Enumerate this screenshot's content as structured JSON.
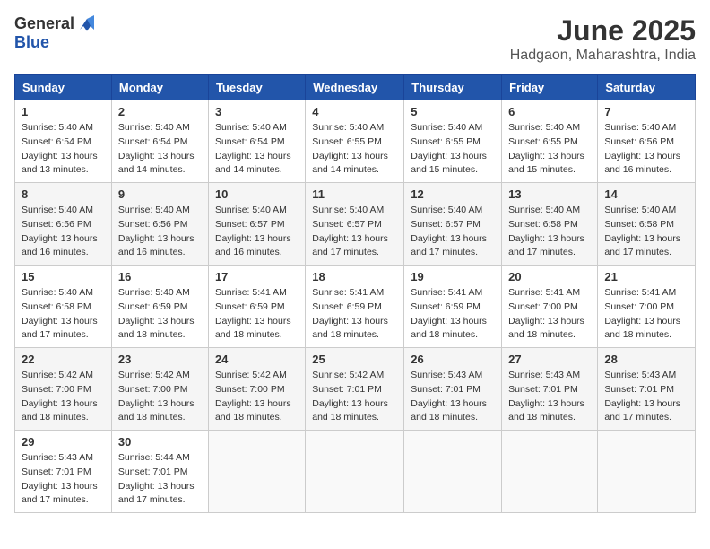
{
  "header": {
    "logo_general": "General",
    "logo_blue": "Blue",
    "month_year": "June 2025",
    "location": "Hadgaon, Maharashtra, India"
  },
  "weekdays": [
    "Sunday",
    "Monday",
    "Tuesday",
    "Wednesday",
    "Thursday",
    "Friday",
    "Saturday"
  ],
  "weeks": [
    [
      {
        "day": "1",
        "sunrise": "Sunrise: 5:40 AM",
        "sunset": "Sunset: 6:54 PM",
        "daylight": "Daylight: 13 hours and 13 minutes."
      },
      {
        "day": "2",
        "sunrise": "Sunrise: 5:40 AM",
        "sunset": "Sunset: 6:54 PM",
        "daylight": "Daylight: 13 hours and 14 minutes."
      },
      {
        "day": "3",
        "sunrise": "Sunrise: 5:40 AM",
        "sunset": "Sunset: 6:54 PM",
        "daylight": "Daylight: 13 hours and 14 minutes."
      },
      {
        "day": "4",
        "sunrise": "Sunrise: 5:40 AM",
        "sunset": "Sunset: 6:55 PM",
        "daylight": "Daylight: 13 hours and 14 minutes."
      },
      {
        "day": "5",
        "sunrise": "Sunrise: 5:40 AM",
        "sunset": "Sunset: 6:55 PM",
        "daylight": "Daylight: 13 hours and 15 minutes."
      },
      {
        "day": "6",
        "sunrise": "Sunrise: 5:40 AM",
        "sunset": "Sunset: 6:55 PM",
        "daylight": "Daylight: 13 hours and 15 minutes."
      },
      {
        "day": "7",
        "sunrise": "Sunrise: 5:40 AM",
        "sunset": "Sunset: 6:56 PM",
        "daylight": "Daylight: 13 hours and 16 minutes."
      }
    ],
    [
      {
        "day": "8",
        "sunrise": "Sunrise: 5:40 AM",
        "sunset": "Sunset: 6:56 PM",
        "daylight": "Daylight: 13 hours and 16 minutes."
      },
      {
        "day": "9",
        "sunrise": "Sunrise: 5:40 AM",
        "sunset": "Sunset: 6:56 PM",
        "daylight": "Daylight: 13 hours and 16 minutes."
      },
      {
        "day": "10",
        "sunrise": "Sunrise: 5:40 AM",
        "sunset": "Sunset: 6:57 PM",
        "daylight": "Daylight: 13 hours and 16 minutes."
      },
      {
        "day": "11",
        "sunrise": "Sunrise: 5:40 AM",
        "sunset": "Sunset: 6:57 PM",
        "daylight": "Daylight: 13 hours and 17 minutes."
      },
      {
        "day": "12",
        "sunrise": "Sunrise: 5:40 AM",
        "sunset": "Sunset: 6:57 PM",
        "daylight": "Daylight: 13 hours and 17 minutes."
      },
      {
        "day": "13",
        "sunrise": "Sunrise: 5:40 AM",
        "sunset": "Sunset: 6:58 PM",
        "daylight": "Daylight: 13 hours and 17 minutes."
      },
      {
        "day": "14",
        "sunrise": "Sunrise: 5:40 AM",
        "sunset": "Sunset: 6:58 PM",
        "daylight": "Daylight: 13 hours and 17 minutes."
      }
    ],
    [
      {
        "day": "15",
        "sunrise": "Sunrise: 5:40 AM",
        "sunset": "Sunset: 6:58 PM",
        "daylight": "Daylight: 13 hours and 17 minutes."
      },
      {
        "day": "16",
        "sunrise": "Sunrise: 5:40 AM",
        "sunset": "Sunset: 6:59 PM",
        "daylight": "Daylight: 13 hours and 18 minutes."
      },
      {
        "day": "17",
        "sunrise": "Sunrise: 5:41 AM",
        "sunset": "Sunset: 6:59 PM",
        "daylight": "Daylight: 13 hours and 18 minutes."
      },
      {
        "day": "18",
        "sunrise": "Sunrise: 5:41 AM",
        "sunset": "Sunset: 6:59 PM",
        "daylight": "Daylight: 13 hours and 18 minutes."
      },
      {
        "day": "19",
        "sunrise": "Sunrise: 5:41 AM",
        "sunset": "Sunset: 6:59 PM",
        "daylight": "Daylight: 13 hours and 18 minutes."
      },
      {
        "day": "20",
        "sunrise": "Sunrise: 5:41 AM",
        "sunset": "Sunset: 7:00 PM",
        "daylight": "Daylight: 13 hours and 18 minutes."
      },
      {
        "day": "21",
        "sunrise": "Sunrise: 5:41 AM",
        "sunset": "Sunset: 7:00 PM",
        "daylight": "Daylight: 13 hours and 18 minutes."
      }
    ],
    [
      {
        "day": "22",
        "sunrise": "Sunrise: 5:42 AM",
        "sunset": "Sunset: 7:00 PM",
        "daylight": "Daylight: 13 hours and 18 minutes."
      },
      {
        "day": "23",
        "sunrise": "Sunrise: 5:42 AM",
        "sunset": "Sunset: 7:00 PM",
        "daylight": "Daylight: 13 hours and 18 minutes."
      },
      {
        "day": "24",
        "sunrise": "Sunrise: 5:42 AM",
        "sunset": "Sunset: 7:00 PM",
        "daylight": "Daylight: 13 hours and 18 minutes."
      },
      {
        "day": "25",
        "sunrise": "Sunrise: 5:42 AM",
        "sunset": "Sunset: 7:01 PM",
        "daylight": "Daylight: 13 hours and 18 minutes."
      },
      {
        "day": "26",
        "sunrise": "Sunrise: 5:43 AM",
        "sunset": "Sunset: 7:01 PM",
        "daylight": "Daylight: 13 hours and 18 minutes."
      },
      {
        "day": "27",
        "sunrise": "Sunrise: 5:43 AM",
        "sunset": "Sunset: 7:01 PM",
        "daylight": "Daylight: 13 hours and 18 minutes."
      },
      {
        "day": "28",
        "sunrise": "Sunrise: 5:43 AM",
        "sunset": "Sunset: 7:01 PM",
        "daylight": "Daylight: 13 hours and 17 minutes."
      }
    ],
    [
      {
        "day": "29",
        "sunrise": "Sunrise: 5:43 AM",
        "sunset": "Sunset: 7:01 PM",
        "daylight": "Daylight: 13 hours and 17 minutes."
      },
      {
        "day": "30",
        "sunrise": "Sunrise: 5:44 AM",
        "sunset": "Sunset: 7:01 PM",
        "daylight": "Daylight: 13 hours and 17 minutes."
      },
      null,
      null,
      null,
      null,
      null
    ]
  ]
}
